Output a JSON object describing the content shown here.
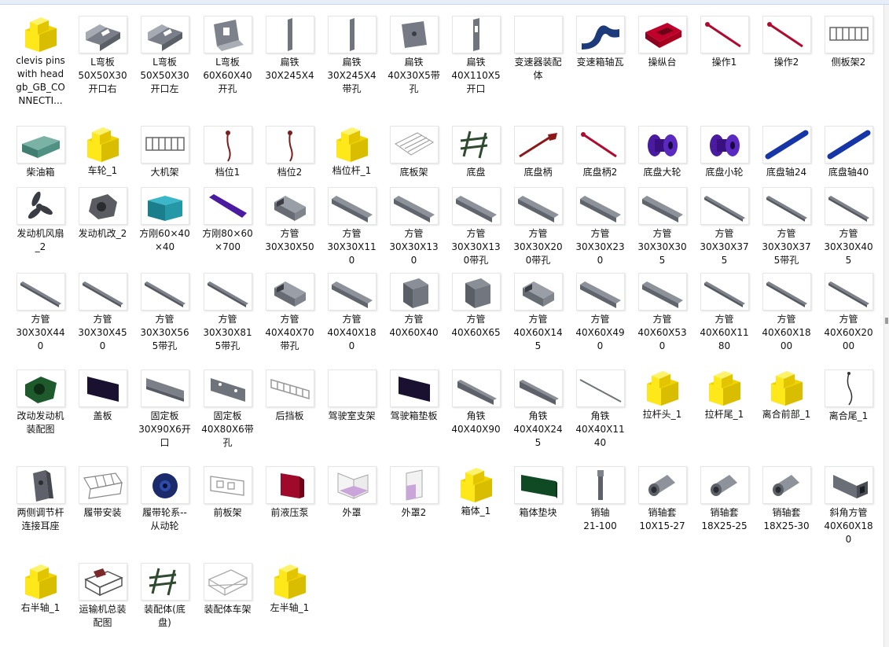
{
  "colors": {
    "shade": "#f8f8f8",
    "ico": "#ffe81a"
  },
  "files": [
    {
      "label": "clevis pins\nwith head\ngb_GB_CO\nNNECTI...",
      "icon": "part-document-icon"
    },
    {
      "label": "L弯板\n50X50X30\n开口右",
      "icon": "l-bracket-icon"
    },
    {
      "label": "L弯板\n50X50X30\n开口左",
      "icon": "l-bracket-icon"
    },
    {
      "label": "L弯板\n60X60X40\n开孔",
      "icon": "l-bracket-hole-icon"
    },
    {
      "label": "扁铁\n30X245X4",
      "icon": "flat-bar-icon"
    },
    {
      "label": "扁铁\n30X245X4\n带孔",
      "icon": "flat-bar-icon"
    },
    {
      "label": "扁铁\n40X30X5带\n孔",
      "icon": "plate-hole-icon"
    },
    {
      "label": "扁铁\n40X110X5\n开口",
      "icon": "flat-slot-icon"
    },
    {
      "label": "变速器装配\n体",
      "icon": "blank-icon"
    },
    {
      "label": "变速箱轴瓦",
      "icon": "bearing-shell-icon"
    },
    {
      "label": "操纵台",
      "icon": "console-icon"
    },
    {
      "label": "操作1",
      "icon": "lever-icon"
    },
    {
      "label": "操作2",
      "icon": "lever-icon"
    },
    {
      "label": "侧板架2",
      "icon": "frame-icon"
    },
    {
      "label": "柴油箱",
      "icon": "tank-icon"
    },
    {
      "label": "车轮_1",
      "icon": "part-document-icon"
    },
    {
      "label": "大机架",
      "icon": "frame-icon"
    },
    {
      "label": "档位1",
      "icon": "gear-shift-icon"
    },
    {
      "label": "档位2",
      "icon": "gear-shift-icon"
    },
    {
      "label": "档位杆_1",
      "icon": "part-document-icon"
    },
    {
      "label": "底板架",
      "icon": "grid-icon"
    },
    {
      "label": "底盘",
      "icon": "chassis-icon"
    },
    {
      "label": "底盘柄",
      "icon": "wrench-icon"
    },
    {
      "label": "底盘柄2",
      "icon": "lever-icon"
    },
    {
      "label": "底盘大轮",
      "icon": "spool-icon"
    },
    {
      "label": "底盘小轮",
      "icon": "spool-icon"
    },
    {
      "label": "底盘轴24",
      "icon": "shaft-icon"
    },
    {
      "label": "底盘轴40",
      "icon": "shaft-icon"
    },
    {
      "label": "发动机风扇\n_2",
      "icon": "fan-icon"
    },
    {
      "label": "发动机改_2",
      "icon": "engine-icon"
    },
    {
      "label": "方刚60×40\n×40",
      "icon": "box-tube-icon"
    },
    {
      "label": "方刚80×60\n×700",
      "icon": "bar-icon"
    },
    {
      "label": "方管\n30X30X50",
      "icon": "short-tube-icon"
    },
    {
      "label": "方管\n30X30X11\n0",
      "icon": "tube-icon"
    },
    {
      "label": "方管\n30X30X13\n0",
      "icon": "tube-icon"
    },
    {
      "label": "方管\n30X30X13\n0带孔",
      "icon": "tube-icon"
    },
    {
      "label": "方管\n30X30X20\n0带孔",
      "icon": "tube-icon"
    },
    {
      "label": "方管\n30X30X23\n0",
      "icon": "tube-icon"
    },
    {
      "label": "方管\n30X30X30\n5",
      "icon": "tube-icon"
    },
    {
      "label": "方管\n30X30X37\n5",
      "icon": "long-tube-icon"
    },
    {
      "label": "方管\n30X30X37\n5带孔",
      "icon": "long-tube-icon"
    },
    {
      "label": "方管\n30X30X40\n5",
      "icon": "long-tube-icon"
    },
    {
      "label": "方管\n30X30X44\n0",
      "icon": "long-tube-icon"
    },
    {
      "label": "方管\n30X30X45\n0",
      "icon": "long-tube-icon"
    },
    {
      "label": "方管\n30X30X56\n5带孔",
      "icon": "long-tube-icon"
    },
    {
      "label": "方管\n30X30X81\n5带孔",
      "icon": "long-tube-icon"
    },
    {
      "label": "方管\n40X40X70\n带孔",
      "icon": "short-tube-icon"
    },
    {
      "label": "方管\n40X40X18\n0",
      "icon": "tube-icon"
    },
    {
      "label": "方管\n40X60X40",
      "icon": "box-icon"
    },
    {
      "label": "方管\n40X60X65",
      "icon": "box-icon"
    },
    {
      "label": "方管\n40X60X14\n5",
      "icon": "short-tube-icon"
    },
    {
      "label": "方管\n40X60X49\n0",
      "icon": "tube-icon"
    },
    {
      "label": "方管\n40X60X53\n0",
      "icon": "tube-icon"
    },
    {
      "label": "方管\n40X60X11\n80",
      "icon": "long-tube-icon"
    },
    {
      "label": "方管\n40X60X18\n00",
      "icon": "long-tube-icon"
    },
    {
      "label": "方管\n40X60X20\n00",
      "icon": "long-tube-icon"
    },
    {
      "label": "改动发动机\n装配图",
      "icon": "engine-assembly-icon"
    },
    {
      "label": "盖板",
      "icon": "dark-plate-icon"
    },
    {
      "label": "固定板\n30X90X6开\n口",
      "icon": "plate-slot-icon"
    },
    {
      "label": "固定板\n40X80X6带\n孔",
      "icon": "plate-holes-icon"
    },
    {
      "label": "后挡板",
      "icon": "ladder-plate-icon"
    },
    {
      "label": "驾驶室支架",
      "icon": "blank-icon"
    },
    {
      "label": "驾驶箱垫板",
      "icon": "dark-plate-icon"
    },
    {
      "label": "角铁\n40X40X90",
      "icon": "angle-icon"
    },
    {
      "label": "角铁\n40X40X24\n5",
      "icon": "angle-icon"
    },
    {
      "label": "角铁\n40X40X11\n40",
      "icon": "thin-rod-icon"
    },
    {
      "label": "拉杆头_1",
      "icon": "part-document-icon"
    },
    {
      "label": "拉杆尾_1",
      "icon": "part-document-icon"
    },
    {
      "label": "离合前部_1",
      "icon": "part-document-icon"
    },
    {
      "label": "离合尾_1",
      "icon": "cable-icon"
    },
    {
      "label": "两侧调节杆\n连接耳座",
      "icon": "ear-seat-icon"
    },
    {
      "label": "履带安装",
      "icon": "track-icon"
    },
    {
      "label": "履带轮系--\n从动轮",
      "icon": "wheel-icon"
    },
    {
      "label": "前板架",
      "icon": "front-frame-icon"
    },
    {
      "label": "前液压泵",
      "icon": "pump-icon"
    },
    {
      "label": "外罩",
      "icon": "cover-icon"
    },
    {
      "label": "外罩2",
      "icon": "cover2-icon"
    },
    {
      "label": "箱体_1",
      "icon": "part-document-icon"
    },
    {
      "label": "箱体垫块",
      "icon": "green-plate-icon"
    },
    {
      "label": "销轴\n21-100",
      "icon": "pin-icon"
    },
    {
      "label": "销轴套\n10X15-27",
      "icon": "sleeve-icon"
    },
    {
      "label": "销轴套\n18X25-25",
      "icon": "sleeve-icon"
    },
    {
      "label": "销轴套\n18X25-30",
      "icon": "sleeve-icon"
    },
    {
      "label": "斜角方管\n40X60X18\n0",
      "icon": "bevel-tube-icon"
    },
    {
      "label": "右半轴_1",
      "icon": "part-document-icon"
    },
    {
      "label": "运输机总装\n配图",
      "icon": "transporter-icon"
    },
    {
      "label": "装配体(底\n盘)",
      "icon": "chassis-icon"
    },
    {
      "label": "装配体车架",
      "icon": "cage-icon"
    },
    {
      "label": "左半轴_1",
      "icon": "part-document-icon"
    }
  ]
}
